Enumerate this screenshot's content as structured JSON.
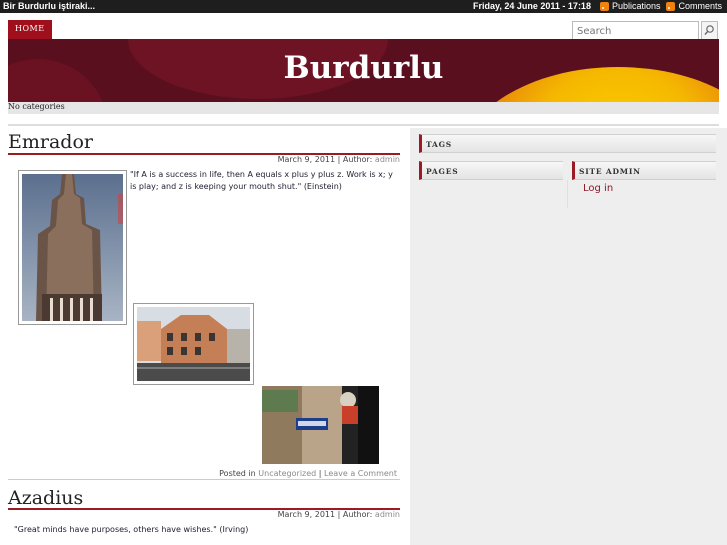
{
  "topbar": {
    "tagline": "Bir Burdurlu iştiraki...",
    "date": "Friday, 24 June 2011 - 17:18",
    "publications": "Publications",
    "comments": "Comments"
  },
  "nav": {
    "home": "HOME"
  },
  "search": {
    "placeholder": "Search"
  },
  "site": {
    "title": "Burdurlu"
  },
  "categories_note": "No categories",
  "posts": [
    {
      "title": "Emrador",
      "date": "March 9, 2011",
      "author_label": "Author:",
      "author": "admin",
      "quote": "\"If A is a success in life, then A equals x plus y plus z. Work is x; y is play; and z is keeping your mouth shut.\"  (Einstein)",
      "posted_in_label": "Posted in",
      "category": "Uncategorized",
      "comment_link": "Leave a Comment"
    },
    {
      "title": "Azadius",
      "date": "March 9, 2011",
      "author_label": "Author:",
      "author": "admin",
      "quote": "\"Great minds have purposes, others have wishes.\" (Irving)"
    }
  ],
  "sidebar": {
    "tags": "TAGS",
    "pages": "PAGES",
    "site_admin": "SITE ADMIN",
    "login": "Log in"
  },
  "colors": {
    "accent": "#9b1a24",
    "banner": "#5a0f1f",
    "rss": "#f0820f"
  },
  "icons": [
    "rss-icon",
    "search-icon"
  ]
}
